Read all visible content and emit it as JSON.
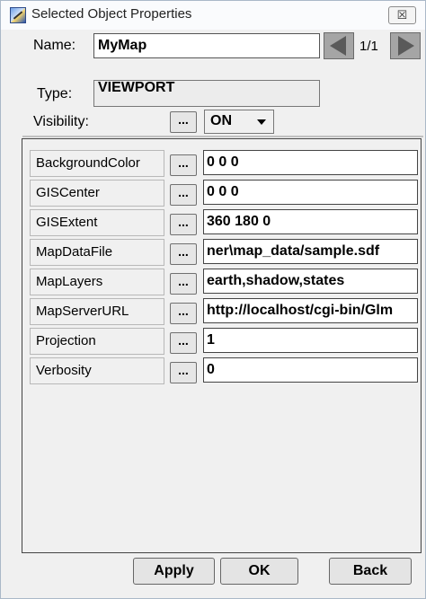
{
  "window": {
    "title": "Selected Object Properties",
    "close_glyph": "☒"
  },
  "header": {
    "name_label": "Name:",
    "name_value": "MyMap",
    "page_counter": "1/1",
    "type_label": "Type:",
    "type_value": "VIEWPORT",
    "visibility_label": "Visibility:",
    "ellipsis": "...",
    "visibility_value": "ON"
  },
  "properties": [
    {
      "name": "BackgroundColor",
      "value": "0 0 0"
    },
    {
      "name": "GISCenter",
      "value": "0 0 0"
    },
    {
      "name": "GISExtent",
      "value": "360 180 0"
    },
    {
      "name": "MapDataFile",
      "value": "ner\\map_data/sample.sdf"
    },
    {
      "name": "MapLayers",
      "value": "earth,shadow,states"
    },
    {
      "name": "MapServerURL",
      "value": "http://localhost/cgi-bin/Glm"
    },
    {
      "name": "Projection",
      "value": "1"
    },
    {
      "name": "Verbosity",
      "value": "0"
    }
  ],
  "buttons": {
    "apply": "Apply",
    "ok": "OK",
    "back": "Back"
  },
  "icons": {
    "window_icon": "pencil-ruler-icon",
    "prev": "left-arrow-icon",
    "next": "right-arrow-icon",
    "dropdown": "chevron-down-icon"
  }
}
